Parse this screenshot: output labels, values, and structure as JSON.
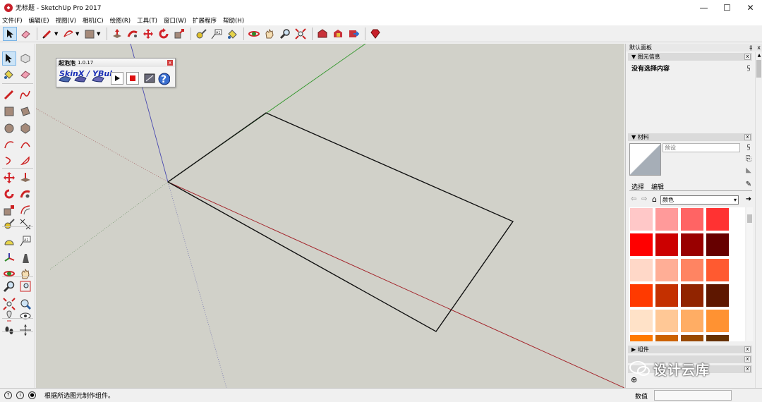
{
  "window": {
    "title": "无标题 - SketchUp Pro 2017"
  },
  "window_controls": {
    "minimize": "—",
    "maximize": "☐",
    "close": "✕"
  },
  "menu": [
    "文件(F)",
    "编辑(E)",
    "视图(V)",
    "相机(C)",
    "绘图(R)",
    "工具(T)",
    "窗口(W)",
    "扩展程序",
    "帮助(H)"
  ],
  "colors": {
    "viewport_bg": "#d1d1c9",
    "red_axis": "#b0282d",
    "green_axis": "#2e8a2a",
    "blue_axis": "#3a3aa8",
    "edge": "#111111",
    "selection": "#cce4f7"
  },
  "plugin": {
    "title": "起泡泡",
    "version": "1.0.17",
    "label": "SkinX / YBub",
    "close": "x"
  },
  "tray": {
    "title": "默认面板",
    "pin": "ǂ",
    "close": "x",
    "entity_info": {
      "header": "▼ 图元信息",
      "empty": "没有选择内容"
    },
    "materials": {
      "header": "▼ 材料",
      "name_placeholder": "预设",
      "tab_select": "选择",
      "tab_edit": "编辑",
      "category": "颜色"
    },
    "components": {
      "header": "▶ 组件"
    },
    "swatch_colors": [
      "#ffc8c8",
      "#ff9a9a",
      "#ff6464",
      "#ff3232",
      "#ff0000",
      "#cc0000",
      "#990000",
      "#660000",
      "#ffd8c8",
      "#ffae96",
      "#ff8462",
      "#ff5a30",
      "#ff3a00",
      "#c43000",
      "#912400",
      "#5e1700",
      "#ffe2c8",
      "#ffc896",
      "#ffad64",
      "#ff9232",
      "#ff7a00",
      "#cc6200",
      "#994900",
      "#663100"
    ]
  },
  "status": {
    "text": "根据所选图元制作组件。",
    "measure_label": "数值",
    "measure_value": ""
  },
  "watermark": {
    "text": "设计云库"
  }
}
